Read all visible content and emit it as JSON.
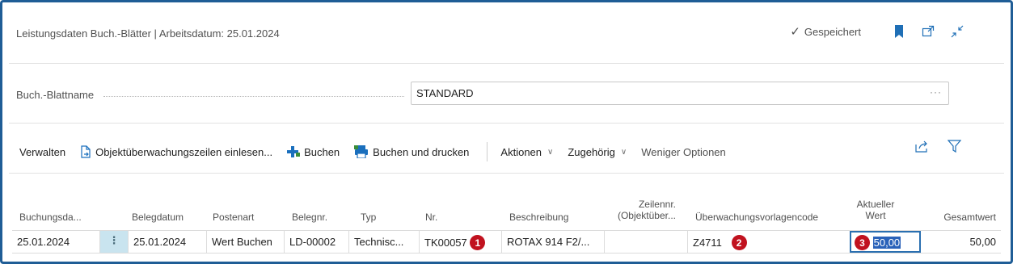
{
  "header": {
    "title": "Leistungsdaten Buch.-Blätter | Arbeitsdatum: 25.01.2024",
    "saved_label": "Gespeichert",
    "icons": [
      "bookmark-icon",
      "open-new-window-icon",
      "collapse-icon"
    ]
  },
  "field": {
    "label": "Buch.-Blattname",
    "value": "STANDARD",
    "more": "···"
  },
  "actions": {
    "manage": "Verwalten",
    "import": "Objektüberwachungszeilen einlesen...",
    "post": "Buchen",
    "post_print": "Buchen und drucken",
    "actions": "Aktionen",
    "related": "Zugehörig",
    "fewer": "Weniger Optionen"
  },
  "table": {
    "headers": {
      "posting_date": "Buchungsda...",
      "document_date": "Belegdatum",
      "entry_type": "Postenart",
      "document_no": "Belegnr.",
      "type": "Typ",
      "no": "Nr.",
      "description": "Beschreibung",
      "line_no_1": "Zeilennr.",
      "line_no_2": "(Objektüber...",
      "template_code": "Überwachungsvorlagencode",
      "current_value_1": "Aktueller",
      "current_value_2": "Wert",
      "total_value": "Gesamtwert"
    },
    "row": {
      "posting_date": "25.01.2024",
      "context_menu": "⋮",
      "document_date": "25.01.2024",
      "entry_type": "Wert Buchen",
      "document_no": "LD-00002",
      "type": "Technisc...",
      "no": "TK00057",
      "description": "ROTAX 914 F2/...",
      "line_no": "",
      "template_code": "Z4711",
      "current_value": "50,00",
      "total_value": "50,00"
    },
    "badges": [
      "1",
      "2",
      "3"
    ]
  },
  "colors": {
    "frame": "#1f5d96",
    "badge": "#c1121f",
    "accent": "#2a62b9",
    "post_icon": "#1a6fbd"
  }
}
